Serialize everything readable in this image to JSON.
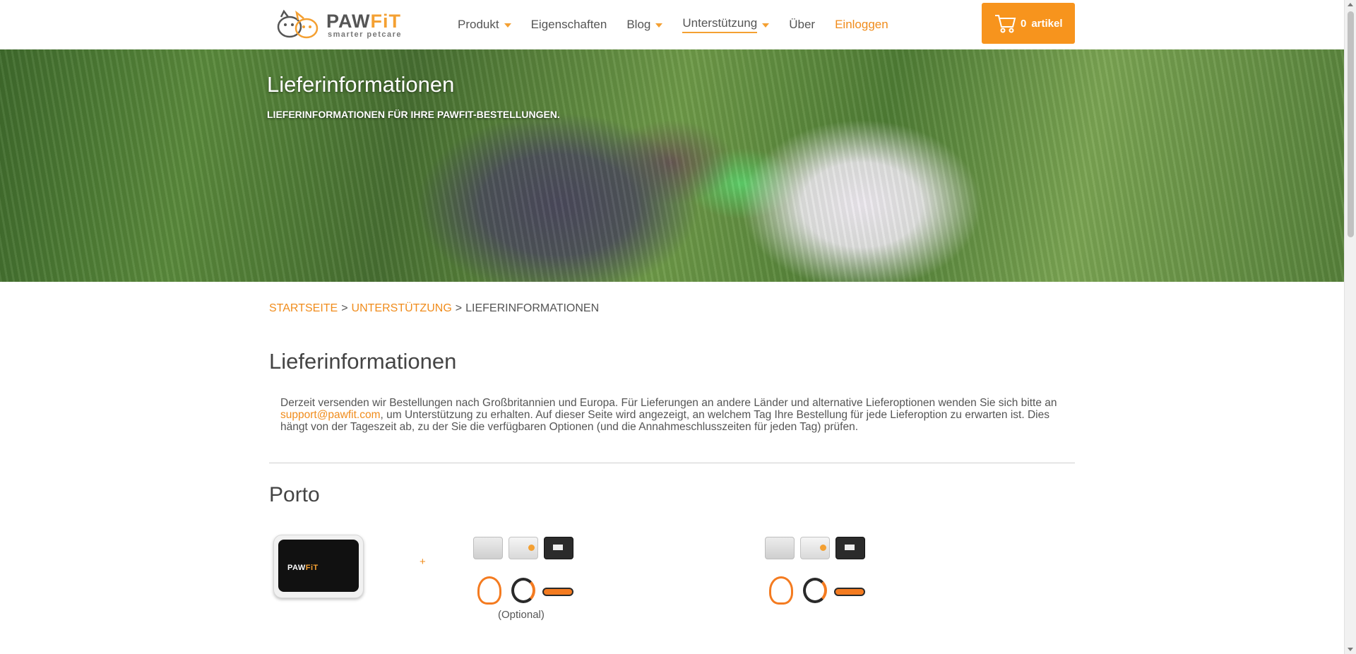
{
  "header": {
    "logo": {
      "word_main": "PAW",
      "word_accent": "FiT",
      "tagline": "smarter petcare"
    },
    "nav": [
      {
        "label": "Produkt",
        "has_dropdown": true
      },
      {
        "label": "Eigenschaften",
        "has_dropdown": false
      },
      {
        "label": "Blog",
        "has_dropdown": true
      },
      {
        "label": "Unterstützung",
        "has_dropdown": true,
        "active": true
      },
      {
        "label": "Über",
        "has_dropdown": false
      },
      {
        "label": "Einloggen",
        "has_dropdown": false
      }
    ],
    "cart": {
      "count": "0",
      "label": "artikel",
      "icon": "shopping-cart-icon"
    }
  },
  "hero": {
    "title": "Lieferinformationen",
    "subtitle": "LIEFERINFORMATIONEN FÜR IHRE PAWFIT-BESTELLUNGEN."
  },
  "breadcrumb": {
    "home": "STARTSEITE",
    "separator": ">",
    "support": "UNTERSTÜTZUNG",
    "current": "LIEFERINFORMATIONEN"
  },
  "main": {
    "title": "Lieferinformationen",
    "intro_before_email": "Derzeit versenden wir Bestellungen nach Großbritannien und Europa. Für Lieferungen an andere Länder und alternative Lieferoptionen wenden Sie sich bitte an ",
    "email": "support@pawfit.com",
    "intro_after_email": ", um Unterstützung zu erhalten. Auf dieser Seite wird angezeigt, an welchem Tag Ihre Bestellung für jede Lieferoption zu erwarten ist. Dies hängt von der Tageszeit ab, zu der Sie die verfügbaren Optionen (und die Annahmeschlusszeiten für jeden Tag) prüfen.",
    "porto": {
      "title": "Porto",
      "device_logo_main": "PAW",
      "device_logo_accent": "FiT",
      "plus": "+",
      "optional_label": "(Optional)"
    }
  },
  "colors": {
    "accent": "#f7941d",
    "link": "#f08c1c",
    "text": "#444444"
  }
}
